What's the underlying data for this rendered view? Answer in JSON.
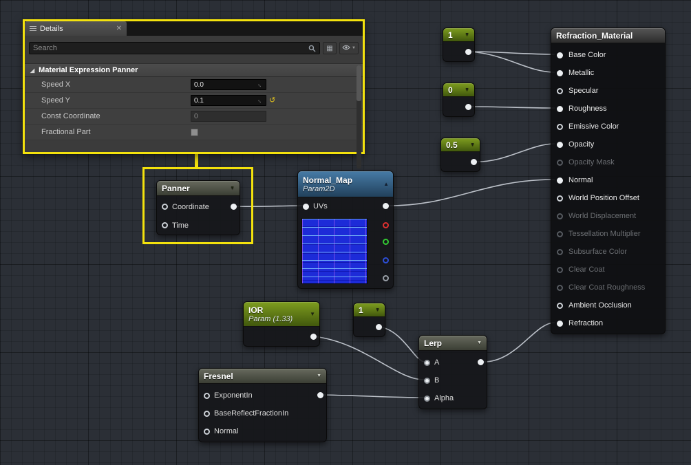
{
  "colors": {
    "highlight_yellow": "#f4e20d",
    "wire": "#c9ced6",
    "const_header_green": "#7e9d1f",
    "texture_header_blue": "#477ba6",
    "function_header_gray": "#676a5e",
    "channel_red": "#e03030",
    "channel_green": "#33cc33",
    "channel_blue": "#2d4fd8",
    "channel_alpha": "#9aa0a8"
  },
  "icons": {
    "close": "✕",
    "caret_down": "▼",
    "collapse_up": "▲",
    "section_expand": "◢",
    "drag_handle": "↔",
    "reset_default": "↺",
    "grid_view": "▦",
    "eye_caret": "▼"
  },
  "details_panel": {
    "tab": "Details",
    "search_placeholder": "Search",
    "section_header": "Material Expression Panner",
    "rows": [
      {
        "label": "Speed X",
        "value": "0.0"
      },
      {
        "label": "Speed Y",
        "value": "0.1"
      },
      {
        "label": "Const Coordinate",
        "value": "0"
      },
      {
        "label": "Fractional Part",
        "value": ""
      }
    ]
  },
  "nodes": {
    "panner": {
      "title": "Panner",
      "inputs": [
        {
          "label": "Coordinate"
        },
        {
          "label": "Time"
        }
      ]
    },
    "normal_map": {
      "title": "Normal_Map",
      "subtitle": "Param2D",
      "inputs": [
        {
          "label": "UVs"
        }
      ]
    },
    "constants": [
      {
        "value": "1"
      },
      {
        "value": "0"
      },
      {
        "value": "0.5"
      },
      {
        "value": "1"
      }
    ],
    "ior": {
      "title": "IOR",
      "subtitle": "Param (1.33)"
    },
    "fresnel": {
      "title": "Fresnel",
      "inputs": [
        {
          "label": "ExponentIn"
        },
        {
          "label": "BaseReflectFractionIn"
        },
        {
          "label": "Normal"
        }
      ]
    },
    "lerp": {
      "title": "Lerp",
      "inputs": [
        {
          "label": "A"
        },
        {
          "label": "B"
        },
        {
          "label": "Alpha"
        }
      ]
    },
    "material": {
      "title": "Refraction_Material",
      "pins": [
        {
          "label": "Base Color",
          "state": "connected"
        },
        {
          "label": "Metallic",
          "state": "connected"
        },
        {
          "label": "Specular",
          "state": "open"
        },
        {
          "label": "Roughness",
          "state": "connected"
        },
        {
          "label": "Emissive Color",
          "state": "open"
        },
        {
          "label": "Opacity",
          "state": "connected"
        },
        {
          "label": "Opacity Mask",
          "state": "disabled"
        },
        {
          "label": "Normal",
          "state": "connected"
        },
        {
          "label": "World Position Offset",
          "state": "open"
        },
        {
          "label": "World Displacement",
          "state": "disabled"
        },
        {
          "label": "Tessellation Multiplier",
          "state": "disabled"
        },
        {
          "label": "Subsurface Color",
          "state": "disabled"
        },
        {
          "label": "Clear Coat",
          "state": "disabled"
        },
        {
          "label": "Clear Coat Roughness",
          "state": "disabled"
        },
        {
          "label": "Ambient Occlusion",
          "state": "open"
        },
        {
          "label": "Refraction",
          "state": "connected"
        }
      ]
    }
  }
}
